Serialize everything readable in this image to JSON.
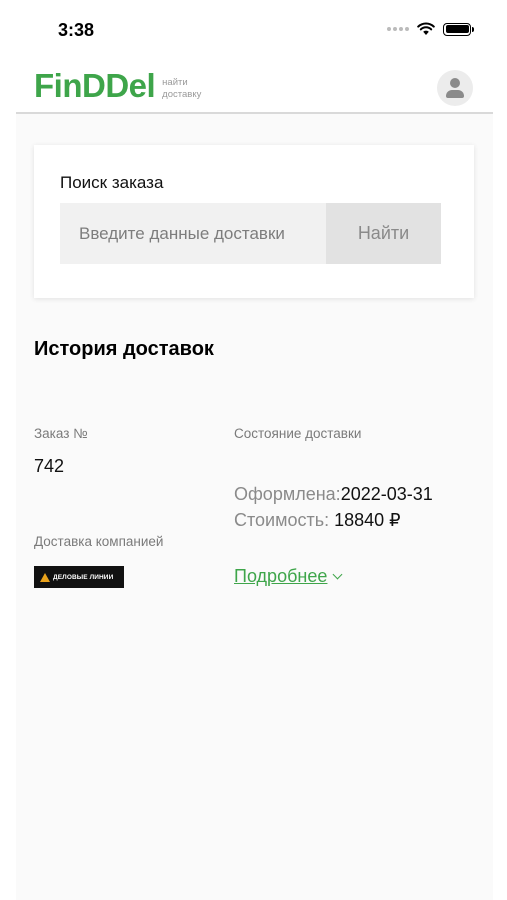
{
  "status_bar": {
    "time": "3:38"
  },
  "header": {
    "logo": "FinDDel",
    "tagline_line1": "найти",
    "tagline_line2": "доставку",
    "brand_color": "#3ea54a"
  },
  "search": {
    "title": "Поиск заказа",
    "placeholder": "Введите данные доставки",
    "button_label": "Найти"
  },
  "history": {
    "title": "История доставок",
    "order_label": "Заказ №",
    "order_number": "742",
    "company_label": "Доставка компанией",
    "company_logo_text": "ДЕЛОВЫЕ ЛИНИИ",
    "status_label": "Состояние доставки",
    "issued_label": "Оформлена:",
    "issued_date": "2022-03-31",
    "cost_label": "Стоимость: ",
    "cost_value": "18840 ₽",
    "more_link": "Подробнее"
  }
}
